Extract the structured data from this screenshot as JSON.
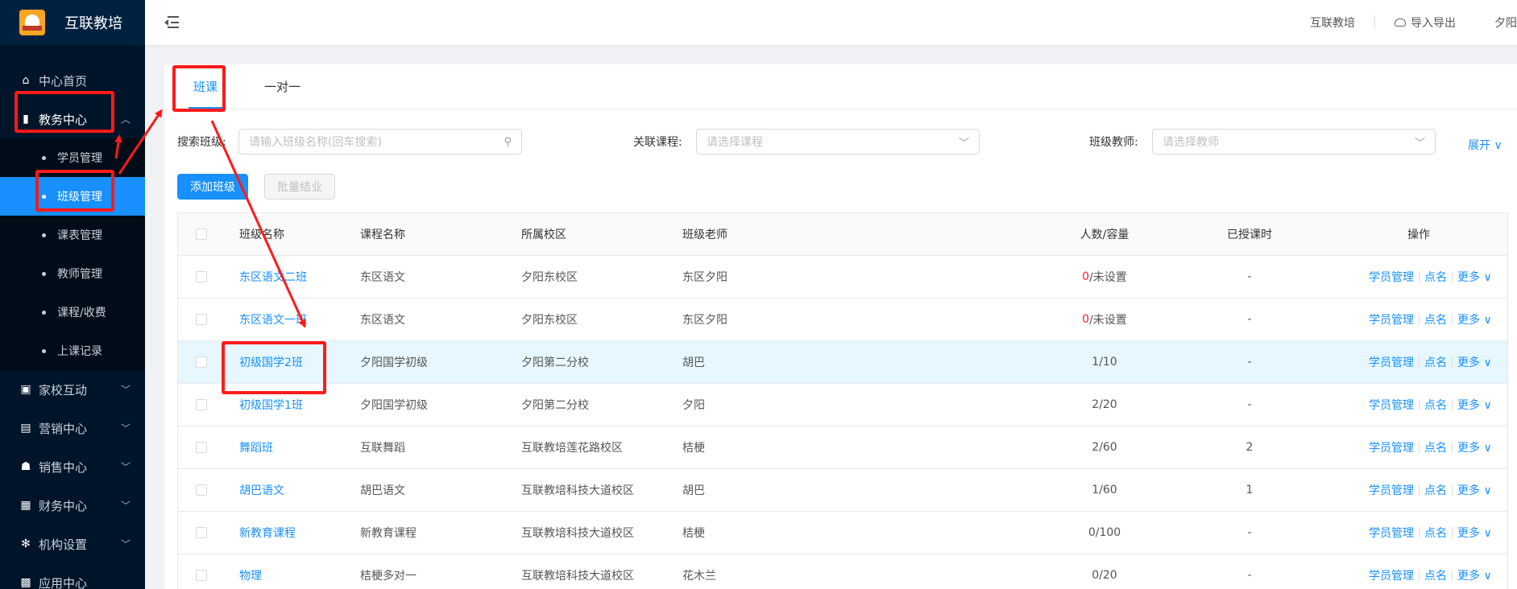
{
  "app": {
    "title": "互联教培"
  },
  "sidebar": {
    "items": [
      {
        "label": "中心首页",
        "icon": "home-icon"
      },
      {
        "label": "教务中心",
        "icon": "book-icon",
        "open": true
      },
      {
        "label": "家校互动",
        "icon": "chat-icon"
      },
      {
        "label": "营销中心",
        "icon": "bag-icon"
      },
      {
        "label": "销售中心",
        "icon": "users-icon"
      },
      {
        "label": "财务中心",
        "icon": "wallet-icon"
      },
      {
        "label": "机构设置",
        "icon": "gear-icon"
      },
      {
        "label": "应用中心",
        "icon": "grid-icon"
      }
    ],
    "submenu": [
      {
        "label": "学员管理"
      },
      {
        "label": "班级管理",
        "active": true
      },
      {
        "label": "课表管理"
      },
      {
        "label": "教师管理"
      },
      {
        "label": "课程/收费"
      },
      {
        "label": "上课记录"
      }
    ]
  },
  "header": {
    "org": "互联教培",
    "import_export": "导入导出",
    "user": "夕阳"
  },
  "tabs": [
    {
      "label": "班课"
    },
    {
      "label": "一对一"
    }
  ],
  "filters": {
    "class_label": "搜索班级:",
    "class_placeholder": "请输入班级名称(回车搜索)",
    "course_label": "关联课程:",
    "course_placeholder": "请选择课程",
    "teacher_label": "班级教师:",
    "teacher_placeholder": "请选择教师",
    "expand": "展开"
  },
  "actions": {
    "add_class": "添加班级",
    "batch_graduate": "批量结业"
  },
  "table": {
    "headers": [
      "班级名称",
      "课程名称",
      "所属校区",
      "班级老师",
      "人数/容量",
      "已授课时",
      "操作"
    ],
    "ops": {
      "manage": "学员管理",
      "rollcall": "点名",
      "more": "更多"
    },
    "rows": [
      {
        "name": "东区语文二班",
        "course": "东区语文",
        "campus": "夕阳东校区",
        "teacher": "东区夕阳",
        "count": "0",
        "capacity": "/未设置",
        "hours": "-"
      },
      {
        "name": "东区语文一班",
        "course": "东区语文",
        "campus": "夕阳东校区",
        "teacher": "东区夕阳",
        "count": "0",
        "capacity": "/未设置",
        "hours": "-"
      },
      {
        "name": "初级国学2班",
        "course": "夕阳国学初级",
        "campus": "夕阳第二分校",
        "teacher": "胡巴",
        "count": "1",
        "capacity": "/10",
        "hours": "-"
      },
      {
        "name": "初级国学1班",
        "course": "夕阳国学初级",
        "campus": "夕阳第二分校",
        "teacher": "夕阳",
        "count": "2",
        "capacity": "/20",
        "hours": "-"
      },
      {
        "name": "舞蹈班",
        "course": "互联舞蹈",
        "campus": "互联教培莲花路校区",
        "teacher": "桔梗",
        "count": "2",
        "capacity": "/60",
        "hours": "2"
      },
      {
        "name": "胡巴语文",
        "course": "胡巴语文",
        "campus": "互联教培科技大道校区",
        "teacher": "胡巴",
        "count": "1",
        "capacity": "/60",
        "hours": "1"
      },
      {
        "name": "新教育课程",
        "course": "新教育课程",
        "campus": "互联教培科技大道校区",
        "teacher": "桔梗",
        "count": "0",
        "capacity": "/100",
        "hours": "-"
      },
      {
        "name": "物理",
        "course": "桔梗多对一",
        "campus": "互联教培科技大道校区",
        "teacher": "花木兰",
        "count": "0",
        "capacity": "/20",
        "hours": "-"
      }
    ]
  }
}
